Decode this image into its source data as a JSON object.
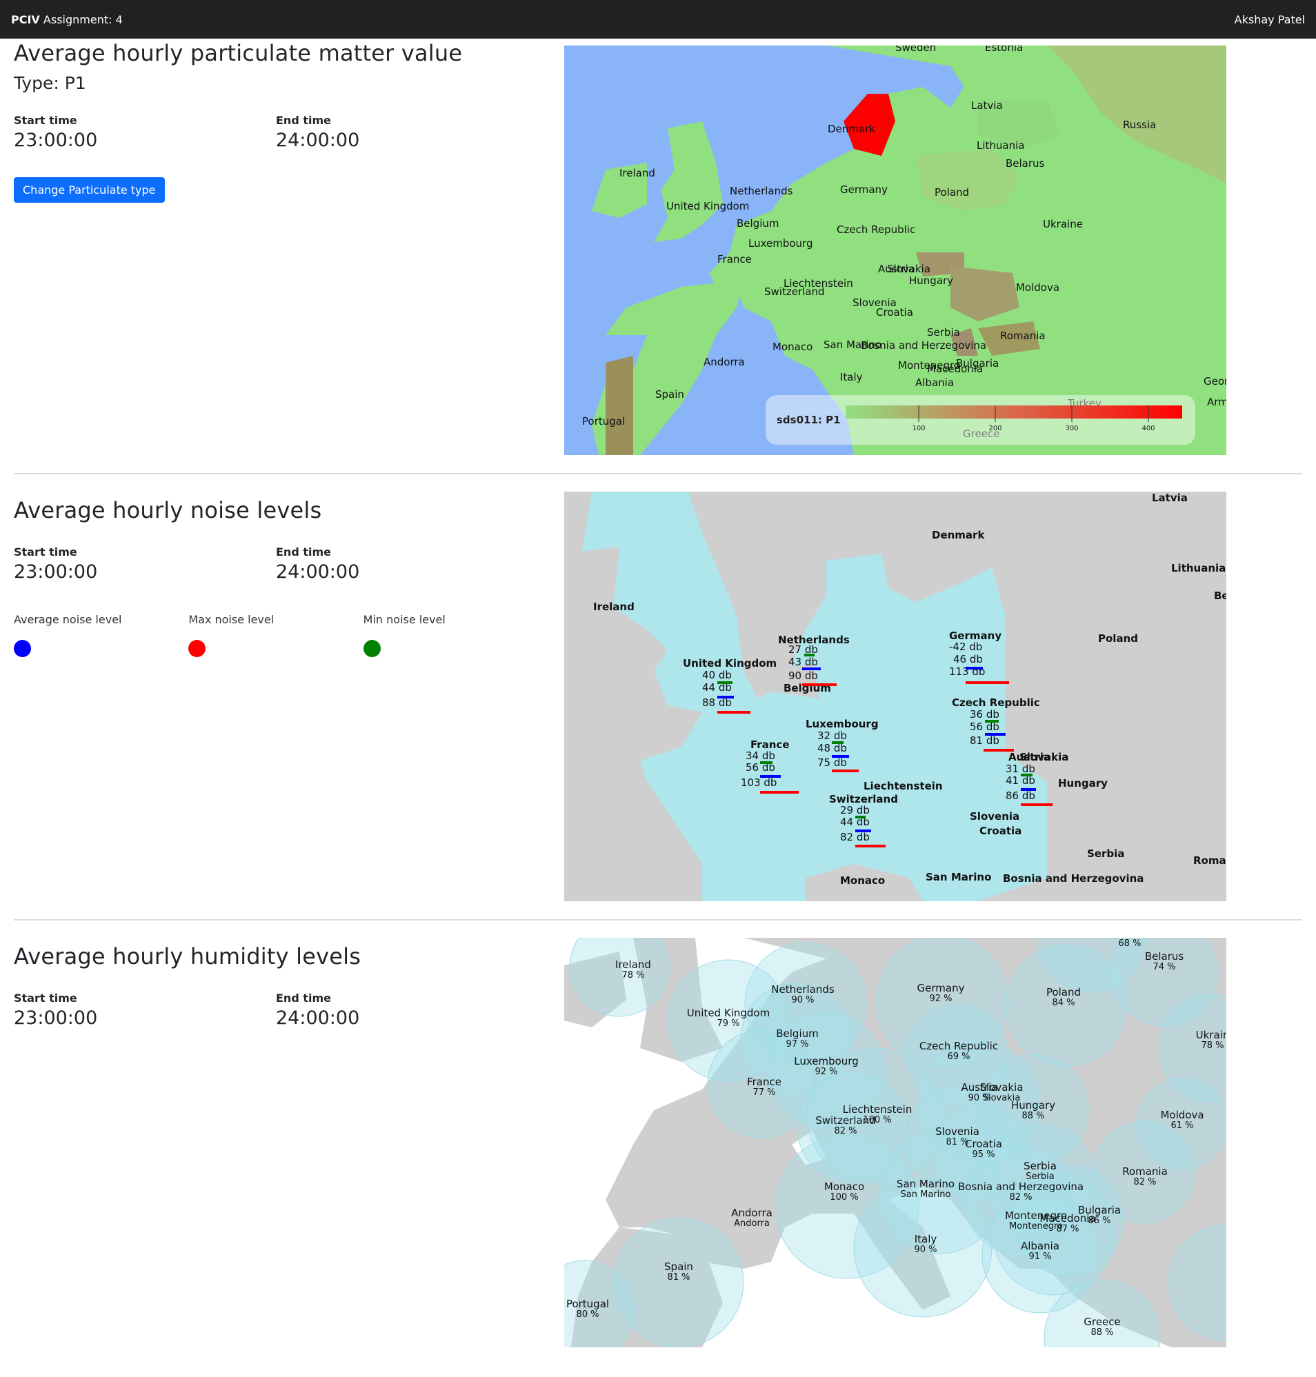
{
  "navbar": {
    "brand": "PCIV",
    "assignment": "Assignment: 4",
    "user": "Akshay Patel"
  },
  "pm": {
    "title": "Average hourly particulate matter value",
    "type_label": "Type: P1",
    "start_label": "Start time",
    "start_value": "23:00:00",
    "end_label": "End time",
    "end_value": "24:00:00",
    "button_label": "Change Particulate type",
    "map": {
      "legend_title": "sds011: P1",
      "legend_ticks": [
        "100",
        "200",
        "300",
        "400"
      ],
      "countries": [
        "Sweden",
        "Estonia",
        "Latvia",
        "Russia",
        "Denmark",
        "Lithuania",
        "Belarus",
        "Ireland",
        "Netherlands",
        "Germany",
        "Poland",
        "United Kingdom",
        "Belgium",
        "Czech Republic",
        "Ukraine",
        "Luxembourg",
        "France",
        "Austria",
        "Slovakia",
        "Hungary",
        "Liechtenstein",
        "Switzerland",
        "Moldova",
        "Slovenia",
        "Croatia",
        "Serbia",
        "Romania",
        "Monaco",
        "San Marino",
        "Bosnia and Herzegovina",
        "Montenegro",
        "Macedonia",
        "Bulgaria",
        "Andorra",
        "Italy",
        "Albania",
        "Spain",
        "Portugal",
        "Greece",
        "Turkey",
        "Georgia",
        "Armenia"
      ]
    }
  },
  "noise": {
    "title": "Average hourly noise levels",
    "start_label": "Start time",
    "start_value": "23:00:00",
    "end_label": "End time",
    "end_value": "24:00:00",
    "legend": {
      "avg": "Average noise level",
      "max": "Max noise level",
      "min": "Min noise level"
    },
    "colors": {
      "avg": "#0000ff",
      "max": "#ff0000",
      "min": "#008000"
    },
    "background_labels": [
      "Latvia",
      "Denmark",
      "Lithuania",
      "Ireland",
      "Poland",
      "Belgium",
      "Hungary",
      "Slovenia",
      "Croatia",
      "Serbia",
      "Monaco",
      "San Marino",
      "Bosnia and Herzegovina",
      "Liechtenstein",
      "Be",
      "Romani",
      "Slovakia"
    ],
    "stations": [
      {
        "name": "Netherlands",
        "min": "27 db",
        "avg": "43 db",
        "max": "90 db"
      },
      {
        "name": "Germany",
        "min": "-42 db",
        "avg": "46 db",
        "max": "113 db"
      },
      {
        "name": "United Kingdom",
        "min": "40 db",
        "avg": "44 db",
        "max": "88 db"
      },
      {
        "name": "Czech Republic",
        "min": "36 db",
        "avg": "56 db",
        "max": "81 db"
      },
      {
        "name": "Luxembourg",
        "min": "32 db",
        "avg": "48 db",
        "max": "75 db"
      },
      {
        "name": "France",
        "min": "34 db",
        "avg": "56 db",
        "max": "103 db"
      },
      {
        "name": "Austria",
        "min": "31 db",
        "avg": "41 db",
        "max": "86 db"
      },
      {
        "name": "Switzerland",
        "min": "29 db",
        "avg": "44 db",
        "max": "82 db"
      }
    ]
  },
  "humidity": {
    "title": "Average hourly humidity levels",
    "start_label": "Start time",
    "start_value": "23:00:00",
    "end_label": "End time",
    "end_value": "24:00:00",
    "items": [
      {
        "name": "Ireland",
        "value": "78 %"
      },
      {
        "name": "Netherlands",
        "value": "90 %"
      },
      {
        "name": "United Kingdom",
        "value": "79 %"
      },
      {
        "name": "Belgium",
        "value": "97 %"
      },
      {
        "name": "Luxembourg",
        "value": "92 %"
      },
      {
        "name": "France",
        "value": "77 %"
      },
      {
        "name": "Germany",
        "value": "92 %"
      },
      {
        "name": "Poland",
        "value": "84 %"
      },
      {
        "name": "Belarus",
        "value": "74 %"
      },
      {
        "name": "",
        "value": "68 %"
      },
      {
        "name": "Ukrain",
        "value": "78 %"
      },
      {
        "name": "Czech Republic",
        "value": "69 %"
      },
      {
        "name": "Austria",
        "value": "90 %"
      },
      {
        "name": "Slovakia",
        "value": "Slovakia"
      },
      {
        "name": "Hungary",
        "value": "88 %"
      },
      {
        "name": "Liechtenstein",
        "value": "100 %"
      },
      {
        "name": "Switzerland",
        "value": "82 %"
      },
      {
        "name": "Slovenia",
        "value": "81 %"
      },
      {
        "name": "Croatia",
        "value": "95 %"
      },
      {
        "name": "Moldova",
        "value": "61 %"
      },
      {
        "name": "Serbia",
        "value": "Serbia"
      },
      {
        "name": "Romania",
        "value": "82 %"
      },
      {
        "name": "Monaco",
        "value": "100 %"
      },
      {
        "name": "San Marino",
        "value": "San Marino"
      },
      {
        "name": "Bosnia and Herzegovina",
        "value": "82 %"
      },
      {
        "name": "Andorra",
        "value": "Andorra"
      },
      {
        "name": "Montenegro",
        "value": "Montenegro"
      },
      {
        "name": "Macedonia",
        "value": "87 %"
      },
      {
        "name": "Bulgaria",
        "value": "86 %"
      },
      {
        "name": "Italy",
        "value": "90 %"
      },
      {
        "name": "Albania",
        "value": "91 %"
      },
      {
        "name": "Spain",
        "value": "81 %"
      },
      {
        "name": "Portugal",
        "value": "80 %"
      },
      {
        "name": "Greece",
        "value": "88 %"
      }
    ]
  }
}
